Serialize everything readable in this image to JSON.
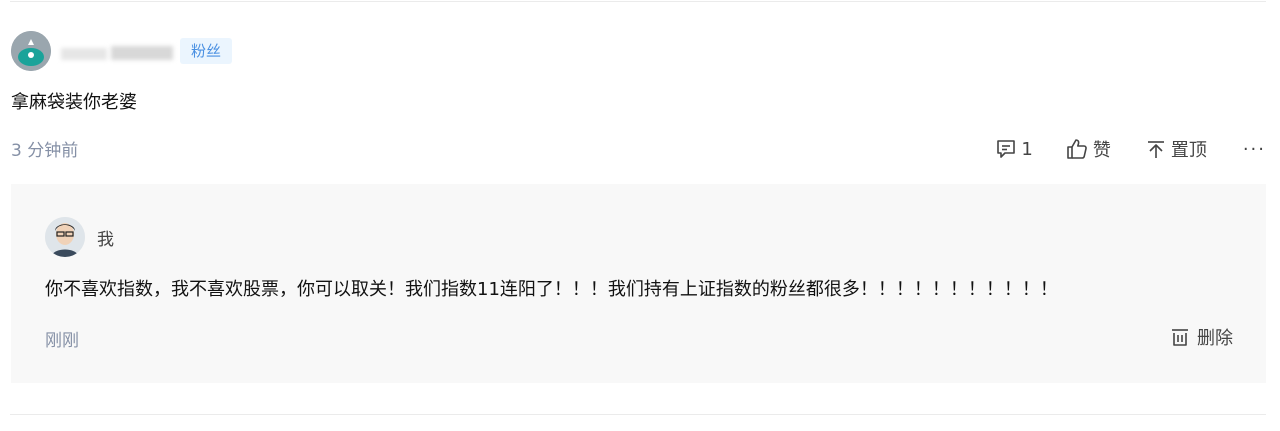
{
  "comment": {
    "badge": "粉丝",
    "text": "拿麻袋装你老婆",
    "time": "3 分钟前",
    "actions": {
      "reply_count": "1",
      "like_label": "赞",
      "pin_label": "置顶",
      "more_label": "···"
    }
  },
  "reply": {
    "author": "我",
    "text": "你不喜欢指数，我不喜欢股票，你可以取关！我们指数11连阳了！！！我们持有上证指数的粉丝都很多！！！！！！！！！！！",
    "time": "刚刚",
    "delete_label": "删除"
  },
  "colors": {
    "badge_bg": "#ebf5fe",
    "badge_text": "#4a90e2",
    "reply_bg": "#f8f8f8",
    "muted_text": "#8590a6"
  }
}
